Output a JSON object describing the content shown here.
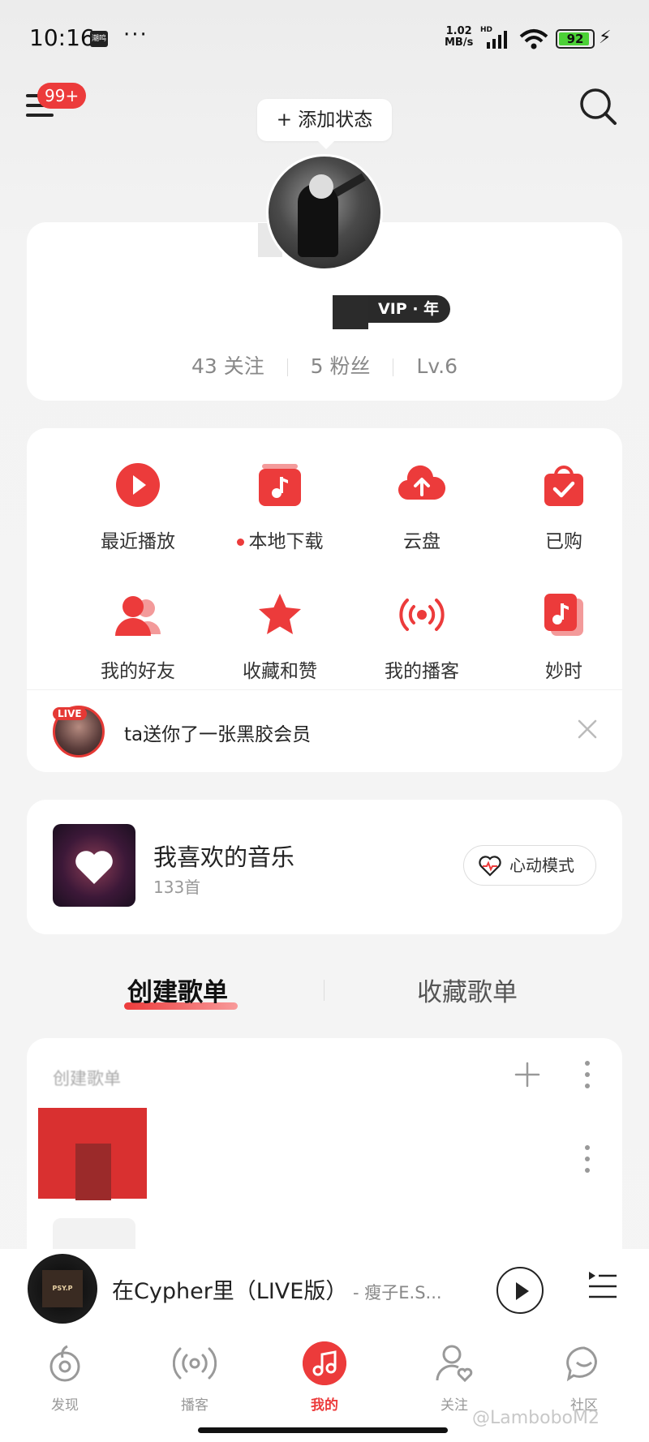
{
  "status_bar": {
    "time": "10:16",
    "app_badge": "潮鸣",
    "more": "···",
    "speed_value": "1.02",
    "speed_unit": "MB/s",
    "hd": "HD",
    "battery": "92"
  },
  "header": {
    "notification_count": "99+",
    "add_status_label": "+ 添加状态"
  },
  "profile": {
    "vip_label": "VIP · 年",
    "follow_count": "43 关注",
    "fans_count": "5 粉丝",
    "level": "Lv.6"
  },
  "shortcuts": [
    {
      "label": "最近播放"
    },
    {
      "label": "本地下载"
    },
    {
      "label": "云盘"
    },
    {
      "label": "已购"
    },
    {
      "label": "我的好友"
    },
    {
      "label": "收藏和赞"
    },
    {
      "label": "我的播客"
    },
    {
      "label": "妙时"
    }
  ],
  "notice": {
    "live_tag": "LIVE",
    "text": "ta送你了一张黑胶会员"
  },
  "liked_music": {
    "title": "我喜欢的音乐",
    "count": "133首",
    "mode_label": "心动模式"
  },
  "playlist_tabs": {
    "created": "创建歌单",
    "collected": "收藏歌单"
  },
  "playlist_section": {
    "header": "创建歌单"
  },
  "now_playing": {
    "title": "在Cypher里（LIVE版）",
    "artist": " - 瘦子E.S...",
    "cover_text": "PSY.P"
  },
  "bottom_nav": [
    {
      "label": "发现"
    },
    {
      "label": "播客"
    },
    {
      "label": "我的"
    },
    {
      "label": "关注"
    },
    {
      "label": "社区"
    }
  ],
  "watermark": "@LamboboM2",
  "colors": {
    "accent": "#ec3b3b",
    "background": "#f5f5f5"
  }
}
